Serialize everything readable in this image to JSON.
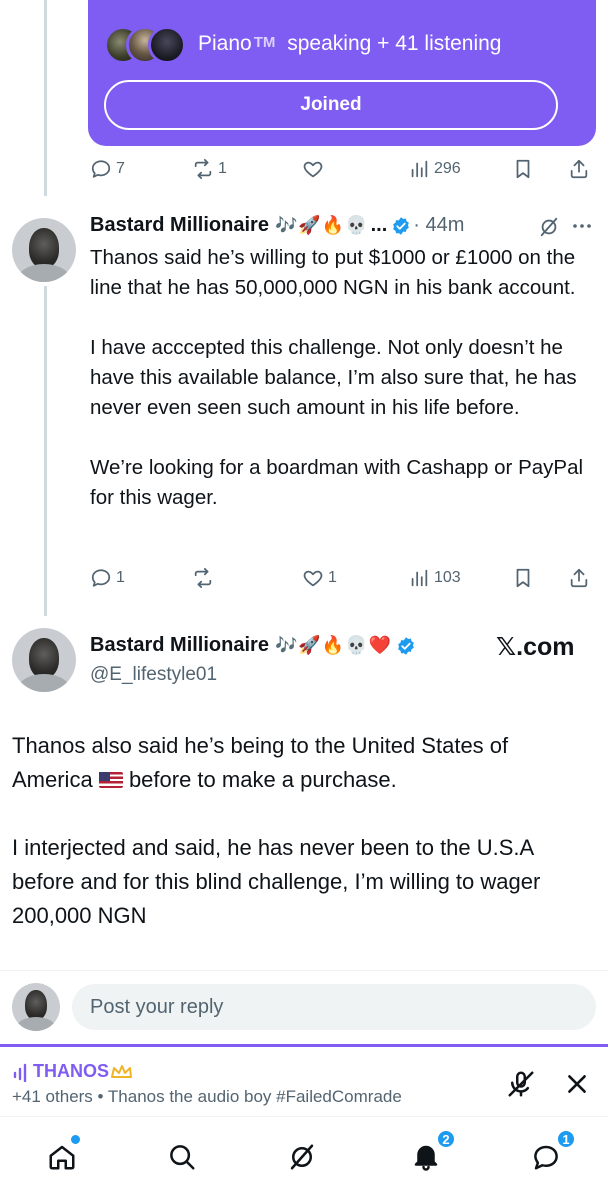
{
  "space": {
    "host": "Piano",
    "host_mark": "TM",
    "status": "speaking + 41 listening",
    "joined_label": "Joined"
  },
  "space_tweet_actions": {
    "replies": "7",
    "reposts": "1",
    "likes": "",
    "views": "296"
  },
  "tweet": {
    "author": "Bastard Millionaire",
    "emojis": "🎶🚀🔥💀",
    "ellipsis": "...",
    "time": "· 44m",
    "paragraphs": [
      "Thanos said he’s willing to put $1000 or £1000 on the line that he has 50,000,000 NGN in his bank account.",
      "I have acccepted this challenge. Not only doesn’t he have this available balance, I’m also sure that, he has never even seen such amount in his life before.",
      "We’re looking for a boardman with Cashapp or PayPal for this wager."
    ],
    "actions": {
      "replies": "1",
      "reposts": "",
      "likes": "1",
      "views": "103"
    }
  },
  "quoted": {
    "author": "Bastard Millionaire",
    "emojis": "🎶🚀🔥💀❤️",
    "handle": "@E_lifestyle01",
    "source": "𝕏.com",
    "para1_start": "Thanos also said he’s being to the United States of America",
    "para1_end": "before to make a purchase.",
    "para2": "I interjected and said, he has never been to the U.S.A before and for this blind challenge, I’m willing to wager 200,000 NGN"
  },
  "reply": {
    "placeholder": "Post your reply"
  },
  "dock": {
    "title": "THANOS",
    "subtitle": "+41 others • Thanos the audio boy #FailedComrade"
  },
  "nav": {
    "notifications_badge": "2",
    "messages_badge": "1"
  },
  "colors": {
    "space_purple": "#7f5cf2",
    "verified_blue": "#1d9bf0",
    "muted_text": "#536471"
  }
}
